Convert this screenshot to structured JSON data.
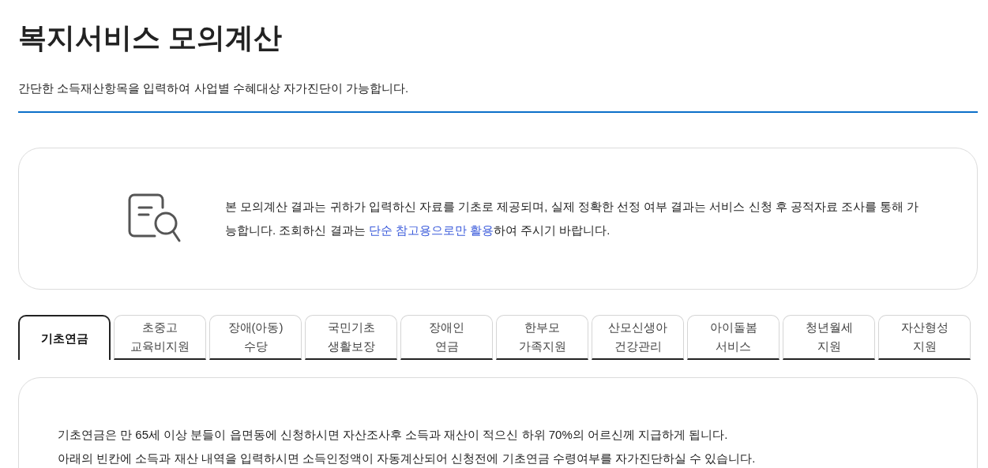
{
  "page": {
    "title": "복지서비스 모의계산",
    "subtitle": "간단한 소득재산항목을 입력하여 사업별 수혜대상 자가진단이 가능합니다."
  },
  "notice": {
    "parts": [
      {
        "text": "본 모의계산 결과는 귀하가 입력하신 자료를 기초로 제공되며, 실제 정확한 선정 여부 결과는 서비스 신청 후 공적자료 조사를 통해 가능합니다. 조회하신 결과는 ",
        "kind": "plain"
      },
      {
        "text": "단순 참고용으로만 활용",
        "kind": "link"
      },
      {
        "text": "하여 주시기 바랍니다.",
        "kind": "plain"
      }
    ]
  },
  "tabs": [
    {
      "label": "기초연금",
      "selected": true
    },
    {
      "label": "초중고\n교육비지원",
      "selected": false
    },
    {
      "label": "장애(아동)\n수당",
      "selected": false
    },
    {
      "label": "국민기초\n생활보장",
      "selected": false
    },
    {
      "label": "장애인\n연금",
      "selected": false
    },
    {
      "label": "한부모\n가족지원",
      "selected": false
    },
    {
      "label": "산모신생아\n건강관리",
      "selected": false
    },
    {
      "label": "아이돌봄\n서비스",
      "selected": false
    },
    {
      "label": "청년월세\n지원",
      "selected": false
    },
    {
      "label": "자산형성\n지원",
      "selected": false
    }
  ],
  "content": {
    "paragraphs": [
      "기초연금은 만 65세 이상 분들이 읍면동에 신청하시면 자산조사후 소득과 재산이 적으신 하위 70%의 어르신께 지급하게 됩니다.",
      "아래의 빈칸에 소득과 재산 내역을 입력하시면 소득인정액이 자동계산되어 신청전에 기초연금 수령여부를 자가진단하실 수 있습니다."
    ]
  }
}
